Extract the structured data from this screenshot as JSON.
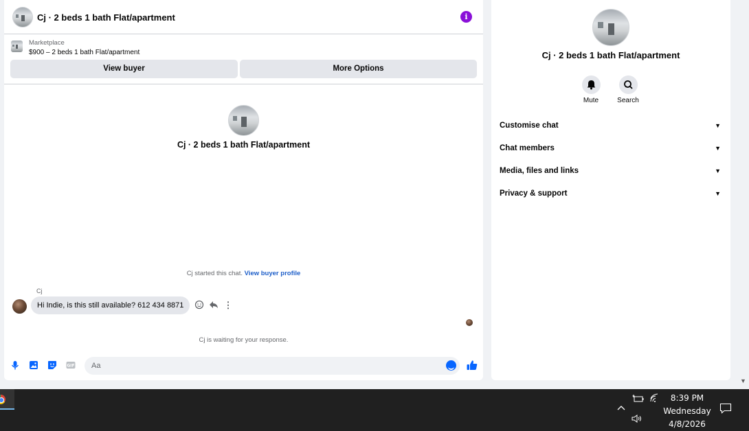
{
  "chat": {
    "header_title": "Cj · 2 beds 1 bath Flat/apartment",
    "marketplace_label": "Marketplace",
    "listing_text": "$900 – 2 beds 1 bath Flat/apartment",
    "view_buyer_label": "View buyer",
    "more_options_label": "More Options",
    "center_title": "Cj · 2 beds 1 bath Flat/apartment",
    "started_text": "Cj started this chat.",
    "view_profile_link": "View buyer profile",
    "sender_name": "Cj",
    "message_text": "Hi Indie, is this still available? 612 434 8871",
    "waiting_text": "Cj is waiting for your response.",
    "composer_placeholder": "Aa",
    "icons": [
      "info-icon",
      "microphone-icon",
      "photo-icon",
      "sticker-icon",
      "gif-icon",
      "emoji-icon",
      "thumbs-up-icon",
      "reaction-icon",
      "reply-icon",
      "more-icon"
    ],
    "accent_color": "#0866ff",
    "info_color": "#8a10d8"
  },
  "details": {
    "title": "Cj · 2 beds 1 bath Flat/apartment",
    "mute_label": "Mute",
    "search_label": "Search",
    "sections": [
      {
        "label": "Customise chat"
      },
      {
        "label": "Chat members"
      },
      {
        "label": "Media, files and links"
      },
      {
        "label": "Privacy & support"
      }
    ],
    "icons": [
      "bell-icon",
      "search-icon",
      "chevron-down-icon"
    ]
  },
  "taskbar": {
    "time": "8:39 PM",
    "day": "Wednesday",
    "date": "4/8/2026",
    "icons": [
      "chrome-icon",
      "chevron-up-icon",
      "battery-icon",
      "wifi-icon",
      "volume-icon",
      "notification-icon"
    ]
  }
}
